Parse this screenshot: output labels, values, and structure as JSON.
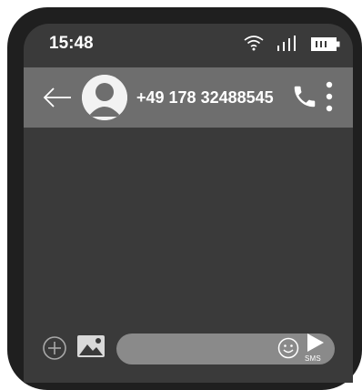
{
  "status_bar": {
    "time": "15:48",
    "icons": [
      "wifi-icon",
      "signal-icon",
      "battery-icon"
    ]
  },
  "header": {
    "contact_name": "+49 178 32488545",
    "icons": [
      "back-arrow-icon",
      "avatar-icon",
      "phone-call-icon",
      "more-vertical-icon"
    ]
  },
  "composer": {
    "input_value": "",
    "input_placeholder": "",
    "send_label": "SMS",
    "icons": [
      "add-circle-icon",
      "image-gallery-icon",
      "emoji-icon",
      "send-icon"
    ]
  },
  "colors": {
    "phone_frame": "#1f1f1f",
    "screen_background": "#3a3a3a",
    "header_background": "#6e6e6e",
    "input_background": "#8a8a8a",
    "foreground": "#ffffff"
  }
}
